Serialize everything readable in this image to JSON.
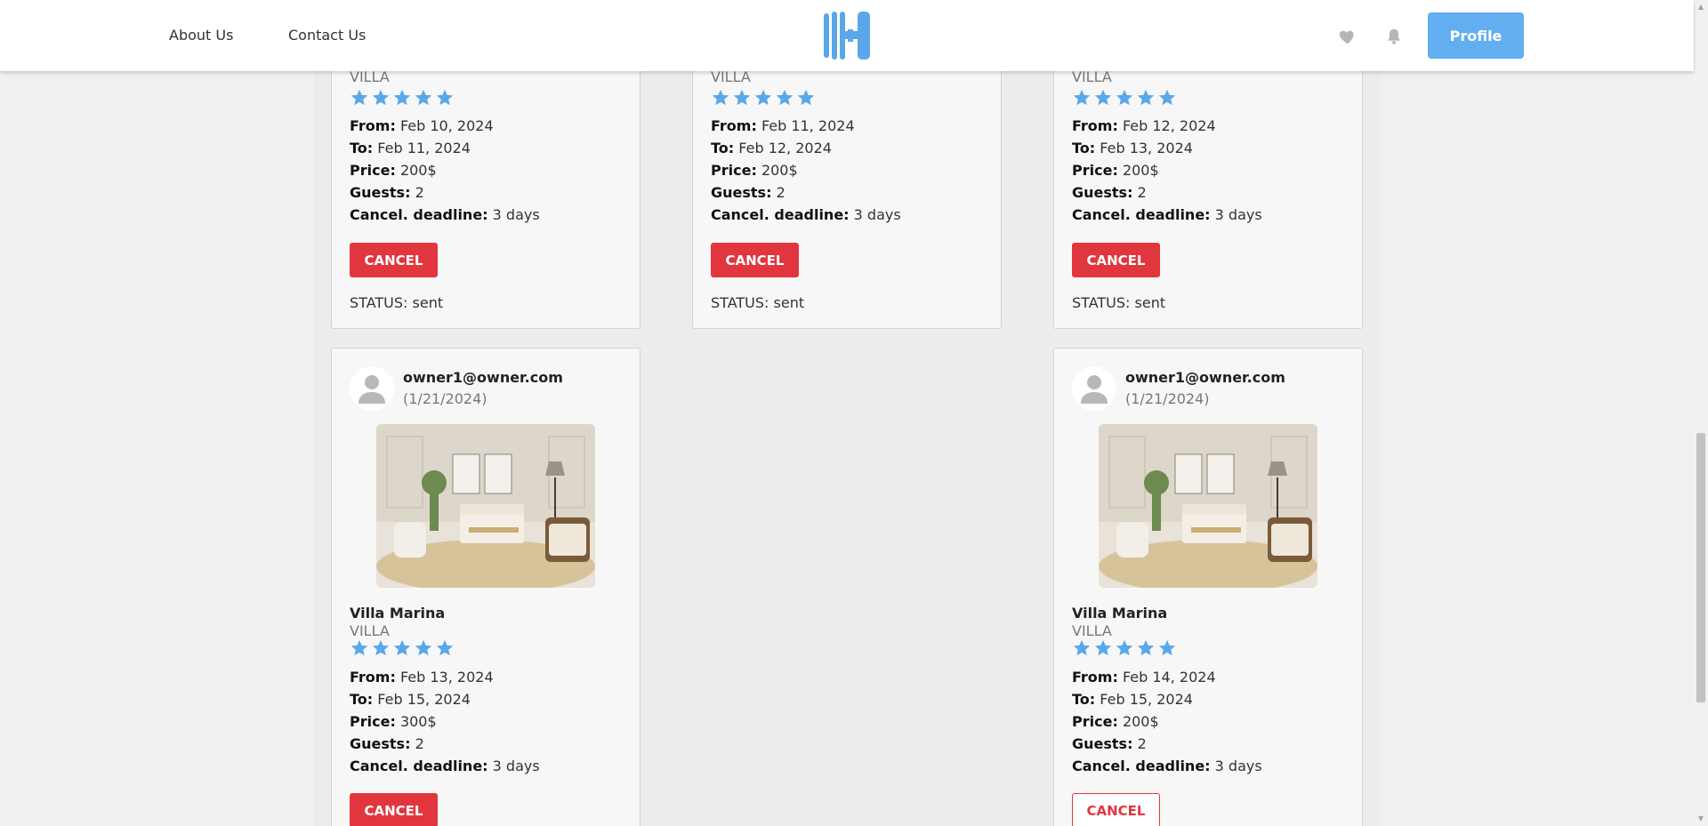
{
  "header": {
    "nav": [
      "About Us",
      "Contact Us"
    ],
    "profile_label": "Profile",
    "icons": [
      "logo-h-icon",
      "heart-icon",
      "bell-icon"
    ],
    "accent_color": "#62aef0"
  },
  "reservations": [
    {
      "type": "VILLA",
      "rating": 5,
      "from_label": "From:",
      "from": "Feb 10, 2024",
      "to_label": "To:",
      "to": "Feb 11, 2024",
      "price_label": "Price:",
      "price": "200$",
      "guests_label": "Guests:",
      "guests": "2",
      "deadline_label": "Cancel. deadline:",
      "deadline": "3 days",
      "cancel_label": "CANCEL",
      "status_label": "STATUS:",
      "status": "sent"
    },
    {
      "type": "VILLA",
      "rating": 5,
      "from_label": "From:",
      "from": "Feb 11, 2024",
      "to_label": "To:",
      "to": "Feb 12, 2024",
      "price_label": "Price:",
      "price": "200$",
      "guests_label": "Guests:",
      "guests": "2",
      "deadline_label": "Cancel. deadline:",
      "deadline": "3 days",
      "cancel_label": "CANCEL",
      "status_label": "STATUS:",
      "status": "sent"
    },
    {
      "type": "VILLA",
      "rating": 5,
      "from_label": "From:",
      "from": "Feb 12, 2024",
      "to_label": "To:",
      "to": "Feb 13, 2024",
      "price_label": "Price:",
      "price": "200$",
      "guests_label": "Guests:",
      "guests": "2",
      "deadline_label": "Cancel. deadline:",
      "deadline": "3 days",
      "cancel_label": "CANCEL",
      "status_label": "STATUS:",
      "status": "sent"
    },
    {
      "owner_email": "owner1@owner.com",
      "owner_date": "(1/21/2024)",
      "name": "Villa Marina",
      "type": "VILLA",
      "rating": 5,
      "from_label": "From:",
      "from": "Feb 13, 2024",
      "to_label": "To:",
      "to": "Feb 15, 2024",
      "price_label": "Price:",
      "price": "300$",
      "guests_label": "Guests:",
      "guests": "2",
      "deadline_label": "Cancel. deadline:",
      "deadline": "3 days",
      "cancel_label": "CANCEL"
    },
    {
      "owner_email": "owner1@owner.com",
      "owner_date": "(1/21/2024)",
      "name": "Villa Marina",
      "type": "VILLA",
      "rating": 5,
      "from_label": "From:",
      "from": "Feb 14, 2024",
      "to_label": "To:",
      "to": "Feb 15, 2024",
      "price_label": "Price:",
      "price": "200$",
      "guests_label": "Guests:",
      "guests": "2",
      "deadline_label": "Cancel. deadline:",
      "deadline": "3 days",
      "cancel_label": "CANCEL"
    }
  ],
  "colors": {
    "star": "#5aa7ea",
    "cancel": "#e1363e"
  }
}
